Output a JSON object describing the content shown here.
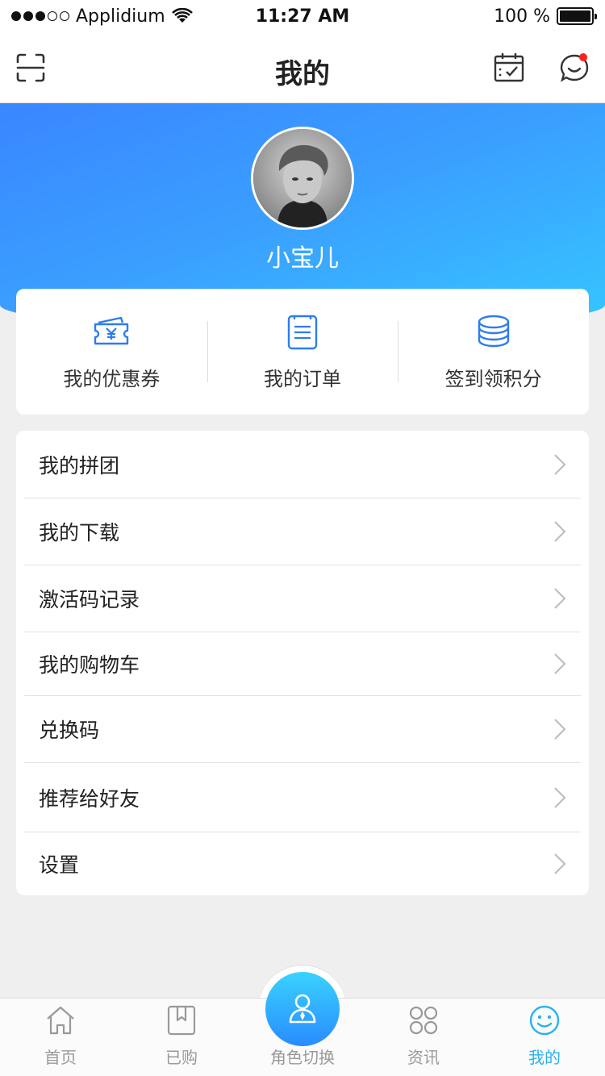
{
  "status": {
    "carrier": "Applidium",
    "time": "11:27 AM",
    "battery": "100 %"
  },
  "nav": {
    "title": "我的"
  },
  "profile": {
    "name": "小宝儿"
  },
  "quick": [
    {
      "label": "我的优惠券",
      "icon": "coupon-icon"
    },
    {
      "label": "我的订单",
      "icon": "order-list-icon"
    },
    {
      "label": "签到领积分",
      "icon": "coins-stack-icon"
    }
  ],
  "menu": [
    "我的拼团",
    "我的下载",
    "激活码记录",
    "我的购物车",
    "兑换码",
    "推荐给好友",
    "设置"
  ],
  "tabs": [
    {
      "label": "首页",
      "icon": "home-icon"
    },
    {
      "label": "已购",
      "icon": "bookmark-book-icon"
    },
    {
      "label": "角色切换",
      "icon": "role-switch-icon"
    },
    {
      "label": "资讯",
      "icon": "grid-circles-icon"
    },
    {
      "label": "我的",
      "icon": "smiley-icon",
      "active": true
    }
  ],
  "colors": {
    "accent": "#2bb1ee",
    "hero_start": "#3a86ff",
    "hero_end": "#36c6ff",
    "badge": "#ff1f1f"
  }
}
